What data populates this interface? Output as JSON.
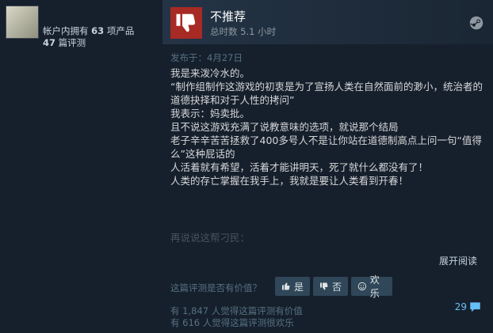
{
  "user": {
    "owned_prefix": "帐户内拥有 ",
    "owned_count": "63",
    "owned_suffix": " 项产品",
    "review_count": "47",
    "review_suffix": " 篇评测"
  },
  "review": {
    "verdict": "不推荐",
    "hours": "总时数 5.1 小时",
    "posted": "发布于：4月27日",
    "paragraphs": [
      "我是来泼冷水的。",
      "“制作组制作这游戏的初衷是为了宣扬人类在自然面前的渺小，统治者的道德抉择和对于人性的拷问”",
      "",
      "我表示：妈卖批。",
      "",
      "且不说这游戏充满了说教意味的选项，就说那个结局",
      "老子辛辛苦苦拯救了400多号人不是让你站在道德制高点上问一句“值得么”这种屁话的",
      "人活着就有希望，活着才能讲明天，死了就什么都没有了！",
      "人类的存亡掌握在我手上，我就是要让人类看到开春！"
    ],
    "faded_line": "再说说这帮刁民：",
    "expand_label": "展开阅读"
  },
  "feedback": {
    "question": "这篇评测是否有价值？",
    "yes_label": "是",
    "no_label": "否",
    "funny_label": "欢乐",
    "helpful_stat": "有 1,847 人觉得这篇评测有价值",
    "funny_stat": "有 616 人觉得这篇评测很欢乐",
    "comment_count": "29"
  },
  "icons": {
    "verdict": "thumbs-down-icon",
    "platform": "steam-icon",
    "yes": "thumbs-up-icon",
    "no": "thumbs-down-icon",
    "funny": "smiley-icon",
    "comments": "speech-bubble-icon"
  },
  "colors": {
    "background": "#1b2838",
    "panel": "#16202d",
    "negative": "#a72a24",
    "link": "#66c0f4",
    "button": "#2f4758"
  }
}
